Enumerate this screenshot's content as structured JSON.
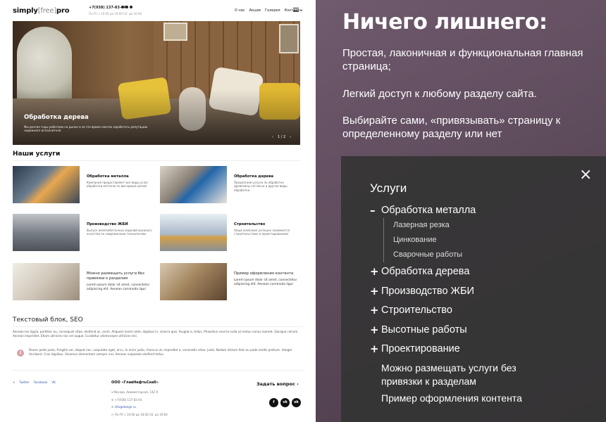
{
  "site": {
    "logo": {
      "a": "simply",
      "b": "[free]",
      "c": "pro"
    },
    "phone": "+7(938) 137-83-44",
    "hours": "Пн-Пт с 10:00 до 18:00 Сб. до 16:00",
    "nav": [
      "О нас",
      "Акции",
      "Галерея",
      "Контакты"
    ],
    "hero": {
      "title": "Обработка дерева",
      "subtitle": "Мы долгие годы работаем на рынке и за это время смогли заработать репутацию надежного исполнителя.",
      "counter": "1 / 2"
    },
    "services_title": "Наши услуги",
    "services": [
      {
        "title": "Обработка металла",
        "desc": "Компания предоставляет все виды услуг обработки металла по выгодным ценам"
      },
      {
        "title": "Обработка дерева",
        "desc": "Предлагаем услуги по обработке древесины согласно и другие виды обработки"
      },
      {
        "title": "Производство ЖБИ",
        "desc": "Выпуск железобетонных изделий высокого качества по современным технологиям"
      },
      {
        "title": "Строительство",
        "desc": "Наша компания успешно занимается строительством и проектированием"
      },
      {
        "title": "Можно размещать услуги без привязки к разделам",
        "desc": "Lorem ipsum dolor sit amet, consectetur adipiscing elit. Aenean commodo ligul"
      },
      {
        "title": "Пример оформления контента",
        "desc": "Lorem ipsum dolor sit amet, consectetur adipiscing elit. Aenean commodo ligul"
      }
    ],
    "seo_title": "Текстовый блок, SEO",
    "seo_text": "Aenean leo ligula, porttitor eu, consequat vitae, eleifend ac, enim. Aliquam lorem ante, dapibus in, viverra quis, feugiat a, tellus. Phasellus viverra nulla ut metus varius laoreet. Quisque rutrum. Aenean imperdiet. Etiam ultricies nisi vel augue. Curabitur ullamcorper ultricies nisi.",
    "alert_icon": "!",
    "alert_text": "Donec pede justo, fringilla vel, aliquet nec, vulputate eget, arcu. In enim justo, rhoncus ut, imperdiet a, venenatis vitae, justo. Nullam dictum felis eu pede mollis pretium. Integer tincidunt. Cras dapibus. Vivamus elementum semper nisi. Aenean vulputate eleifend tellus.",
    "footer": {
      "share": [
        "Twitter",
        "Facebook",
        "VK"
      ],
      "org": "ООО «ГлавНефтьСнаб»",
      "contacts": [
        "Москва, Авиамоторная, 14Z К",
        "+7(938) 137-83-44",
        "info@design.ru",
        "Пн-Пт с 10:00 до 18:00 Сб. до 16:00"
      ],
      "ask": "Задать вопрос",
      "social_icons": [
        "f",
        "vk",
        "ok"
      ]
    }
  },
  "promo": {
    "title": "Ничего лишнего:",
    "paragraphs": [
      "Простая, лаконичная и функциональная главная страница;",
      "Легкий доступ к любому разделу сайта.",
      "Выбирайте сами, «привязывать» страницу к определенному разделу или нет"
    ]
  },
  "menu": {
    "close": "×",
    "title": "Услуги",
    "expanded": {
      "label": "Обработка металла",
      "sub": [
        "Лазерная резка",
        "Цинкование",
        "Сварочные работы"
      ]
    },
    "collapsed": [
      "Обработка дерева",
      "Производство ЖБИ",
      "Строительство",
      "Высотные работы",
      "Проектирование"
    ],
    "plain": [
      "Можно размещать услуги без привязки к разделам",
      "Пример оформления контента"
    ],
    "sym_open": "–",
    "sym_closed": "+"
  }
}
